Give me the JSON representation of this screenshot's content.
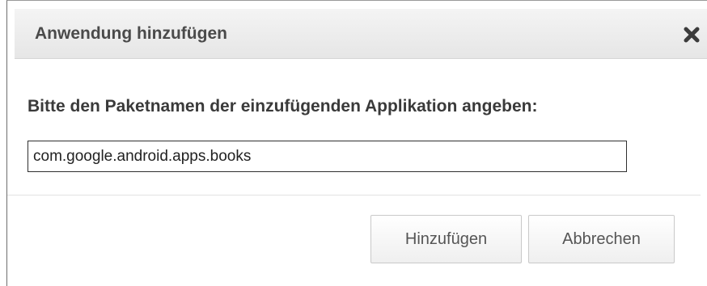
{
  "dialog": {
    "title": "Anwendung hinzufügen",
    "close_icon": "close-icon",
    "prompt": "Bitte den Paketnamen der einzufügenden Applikation angeben:",
    "package_input": {
      "value": "com.google.android.apps.books"
    },
    "buttons": {
      "add_label": "Hinzufügen",
      "cancel_label": "Abbrechen"
    }
  },
  "colors": {
    "title_text": "#4a4a4a",
    "titlebar_bg": "#ececec",
    "button_text": "#555555"
  }
}
